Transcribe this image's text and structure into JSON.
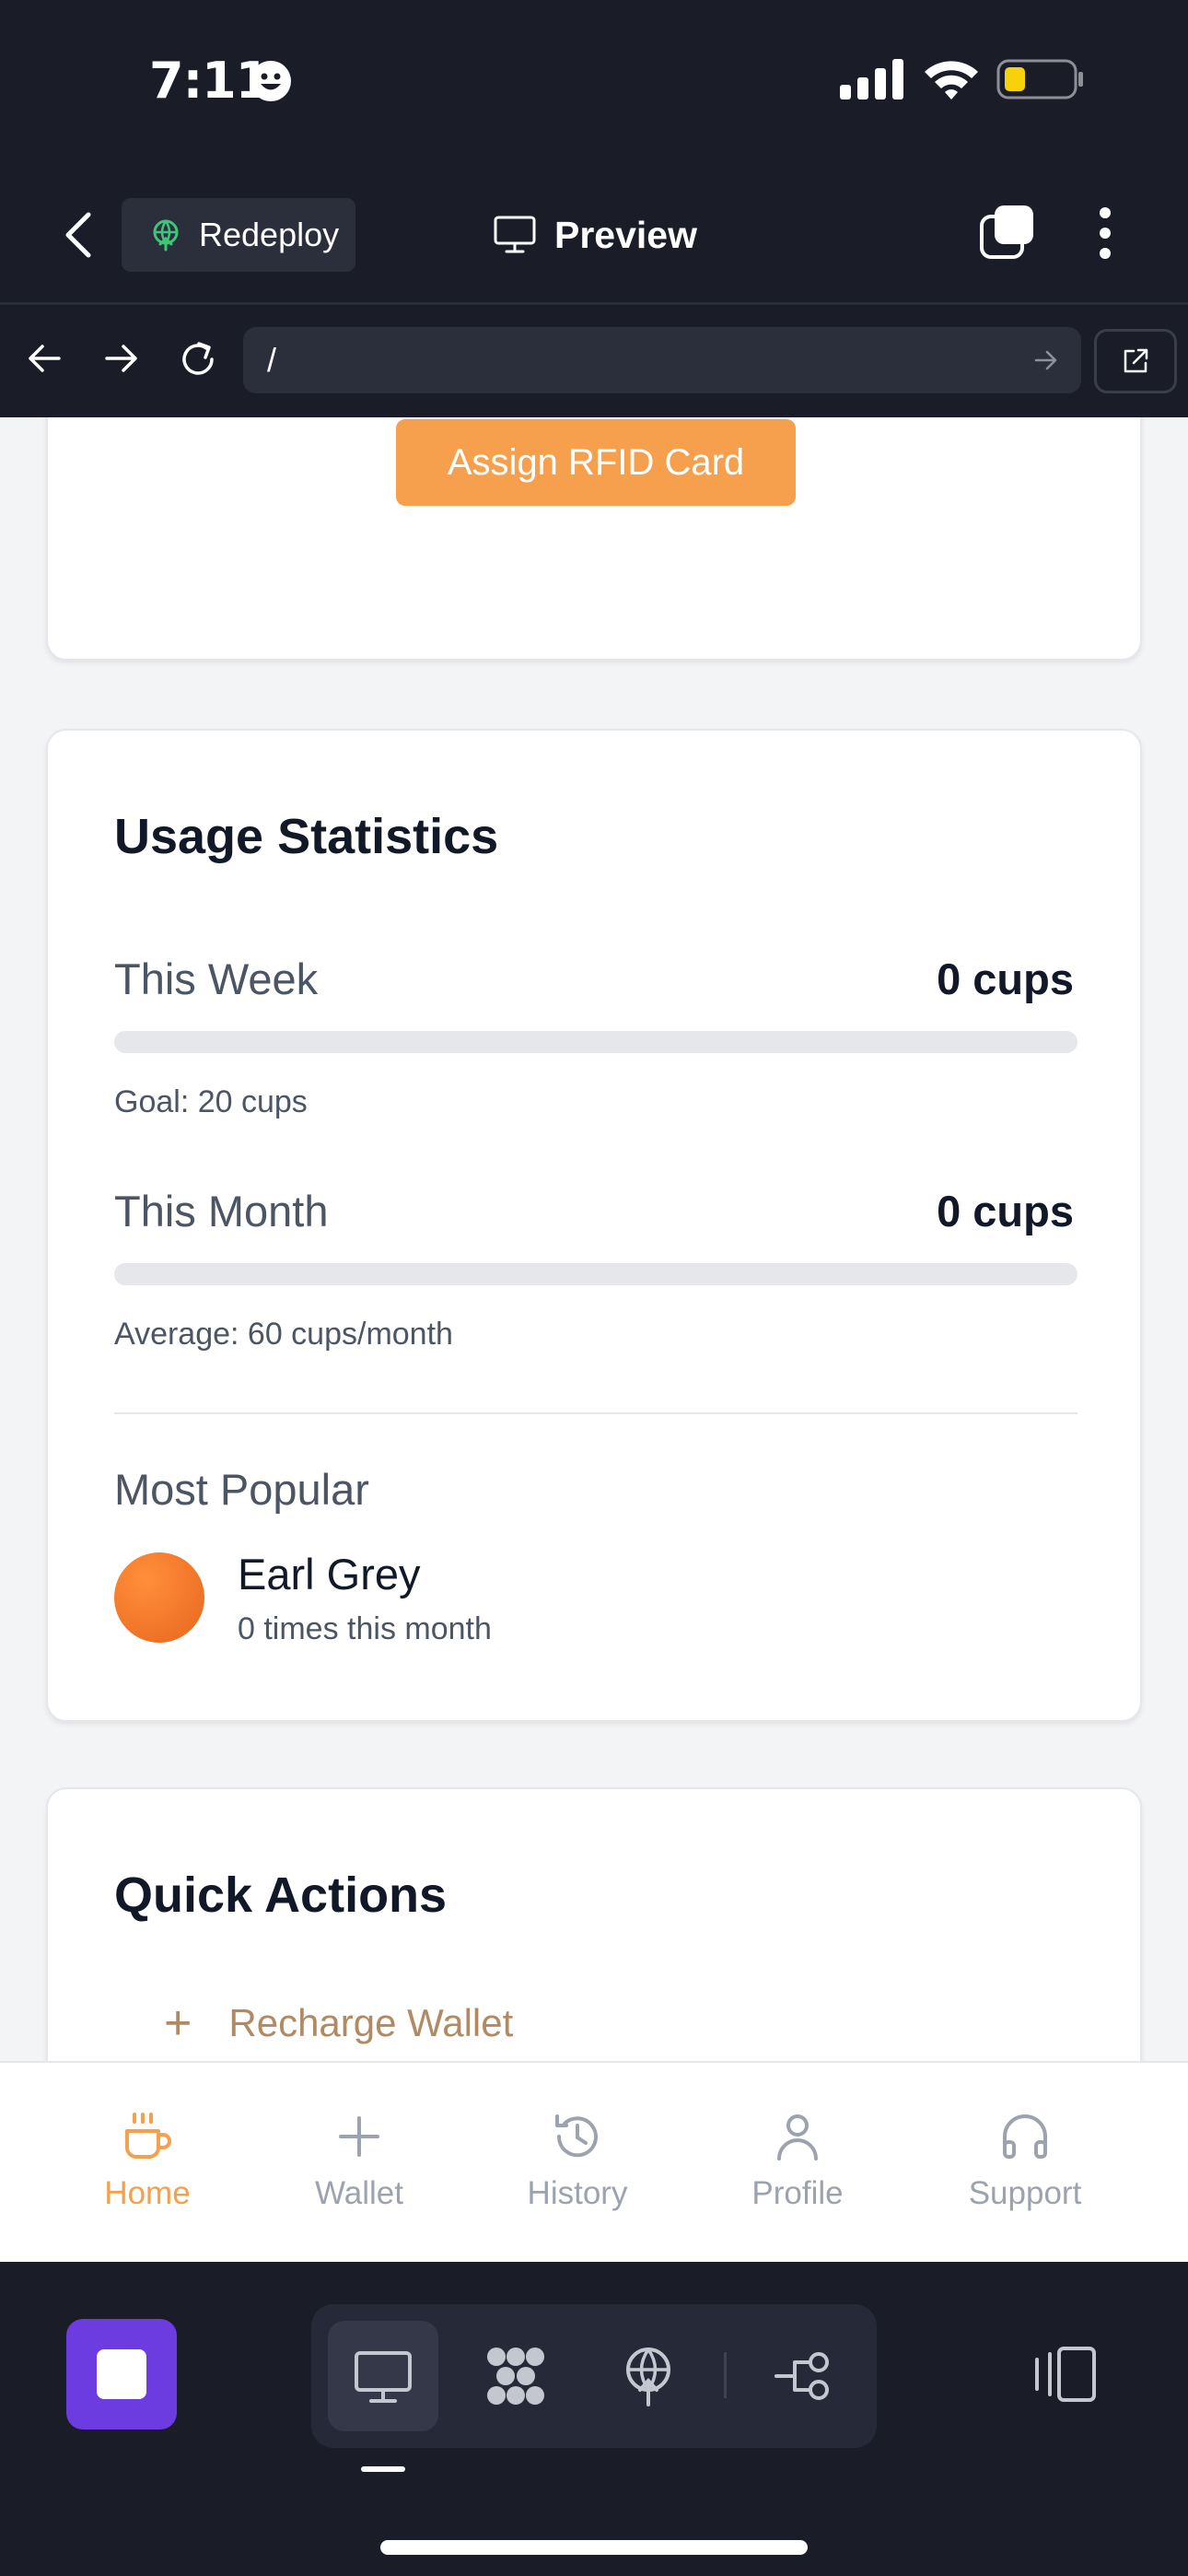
{
  "status_bar": {
    "time": "7:11",
    "icons": [
      "smiley-face-icon",
      "cellular-signal-icon",
      "wifi-icon",
      "battery-low-icon"
    ]
  },
  "header": {
    "back_icon": "chevron-left-icon",
    "redeploy_label": "Redeploy",
    "preview_label": "Preview",
    "icons": [
      "globe-icon",
      "monitor-icon",
      "tabs-icon",
      "more-vertical-icon"
    ]
  },
  "browser": {
    "url": "/",
    "icons": [
      "arrow-left-icon",
      "arrow-right-icon",
      "reload-icon",
      "go-arrow-icon",
      "open-external-icon"
    ]
  },
  "rfid_card": {
    "assign_label": "Assign RFID Card"
  },
  "usage": {
    "title": "Usage Statistics",
    "week": {
      "label": "This Week",
      "value": "0 cups",
      "progress": 0,
      "note": "Goal: 20 cups"
    },
    "month": {
      "label": "This Month",
      "value": "0 cups",
      "progress": 0,
      "note": "Average: 60 cups/month"
    },
    "popular": {
      "label": "Most Popular",
      "name": "Earl Grey",
      "meta": "0 times this month"
    }
  },
  "quick_actions": {
    "title": "Quick Actions",
    "items": [
      {
        "label": "Recharge Wallet",
        "icon": "plus-icon"
      }
    ]
  },
  "tab_bar": {
    "tabs": [
      {
        "label": "Home",
        "icon": "coffee-cup-icon",
        "active": true
      },
      {
        "label": "Wallet",
        "icon": "plus-icon",
        "active": false
      },
      {
        "label": "History",
        "icon": "history-icon",
        "active": false
      },
      {
        "label": "Profile",
        "icon": "user-icon",
        "active": false
      },
      {
        "label": "Support",
        "icon": "headphones-icon",
        "active": false
      }
    ]
  },
  "colors": {
    "accent": "#f6a04d",
    "dark_bg": "#1a1c28",
    "stop_button": "#6c3ce0",
    "muted_action": "#b08a63"
  },
  "dev_toolbar": {
    "icons": [
      "stop-icon",
      "monitor-icon",
      "apps-grid-icon",
      "deploy-globe-icon",
      "branch-icon",
      "layout-toggle-icon"
    ]
  }
}
